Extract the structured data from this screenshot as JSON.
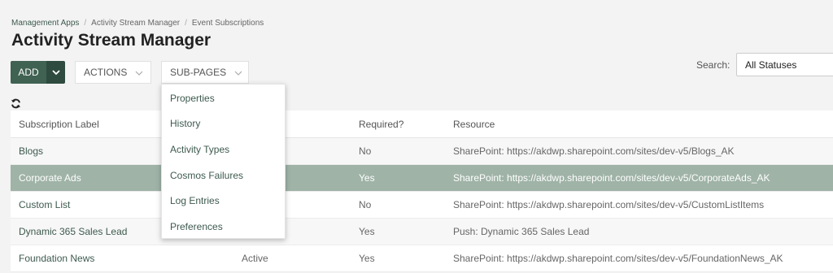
{
  "breadcrumb": [
    "Management Apps",
    "Activity Stream Manager",
    "Event Subscriptions"
  ],
  "breadcrumb_separator": "/",
  "page_title": "Activity Stream Manager",
  "toolbar": {
    "add_label": "ADD",
    "actions_label": "ACTIONS",
    "subpages_label": "SUB-PAGES"
  },
  "search": {
    "label": "Search:",
    "selected": "All Statuses"
  },
  "subpages_menu": [
    "Properties",
    "History",
    "Activity Types",
    "Cosmos Failures",
    "Log Entries",
    "Preferences"
  ],
  "table": {
    "columns": {
      "label": "Subscription Label",
      "required": "Required?",
      "resource": "Resource"
    },
    "rows": [
      {
        "label": "Blogs",
        "status": "",
        "required": "No",
        "resource": "SharePoint: https://akdwp.sharepoint.com/sites/dev-v5/Blogs_AK"
      },
      {
        "label": "Corporate Ads",
        "status": "",
        "required": "Yes",
        "resource": "SharePoint: https://akdwp.sharepoint.com/sites/dev-v5/CorporateAds_AK"
      },
      {
        "label": "Custom List",
        "status": "",
        "required": "No",
        "resource": "SharePoint: https://akdwp.sharepoint.com/sites/dev-v5/CustomListItems"
      },
      {
        "label": "Dynamic 365 Sales Lead",
        "status": "",
        "required": "Yes",
        "resource": "Push: Dynamic 365 Sales Lead"
      },
      {
        "label": "Foundation News",
        "status": "Active",
        "required": "Yes",
        "resource": "SharePoint: https://akdwp.sharepoint.com/sites/dev-v5/FoundationNews_AK"
      }
    ]
  },
  "colors": {
    "primary": "#3f6252",
    "selected_row": "#9fb3a7"
  }
}
